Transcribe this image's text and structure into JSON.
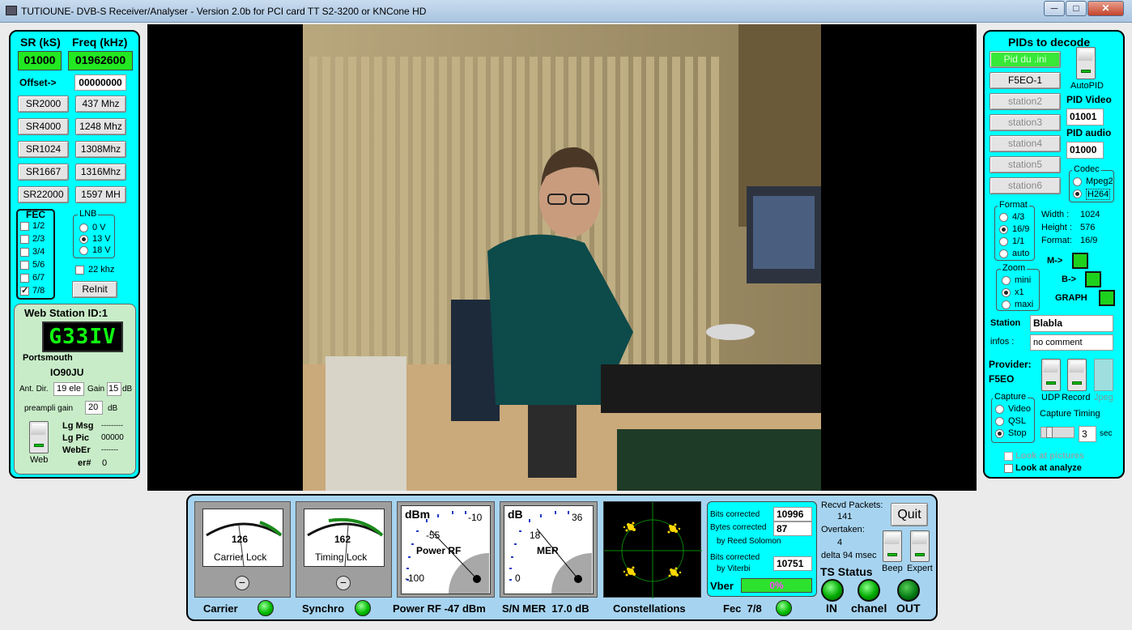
{
  "window": {
    "title": "TUTIOUNE- DVB-S Receiver/Analyser - Version 2.0b for PCI card TT S2-3200 or KNCone HD",
    "btn_min": "─",
    "btn_max": "□",
    "btn_close": "✕"
  },
  "left": {
    "sr_label": "SR (kS)",
    "freq_label": "Freq (kHz)",
    "sr_value": "01000",
    "freq_value": "01962600",
    "offset_label": "Offset->",
    "offset_value": "00000000",
    "sr_buttons": [
      "SR2000",
      "SR4000",
      "SR1024",
      "SR1667",
      "SR22000"
    ],
    "freq_buttons": [
      "437 Mhz",
      "1248 Mhz",
      "1308Mhz",
      "1316Mhz",
      "1597 MH"
    ],
    "fec_label": "FEC",
    "fec_options": [
      {
        "label": "1/2",
        "checked": false
      },
      {
        "label": "2/3",
        "checked": false
      },
      {
        "label": "3/4",
        "checked": false
      },
      {
        "label": "5/6",
        "checked": false
      },
      {
        "label": "6/7",
        "checked": false
      },
      {
        "label": "7/8",
        "checked": true
      }
    ],
    "lnb_label": "LNB",
    "lnb_options": [
      {
        "label": "0 V",
        "selected": false
      },
      {
        "label": "13 V",
        "selected": true
      },
      {
        "label": "18 V",
        "selected": false
      }
    ],
    "khz_label": "22 khz",
    "reinit_label": "ReInit",
    "web": {
      "title": "Web Station ID:1",
      "lcd": "G3ЗIV",
      "location": "Portsmouth",
      "locator": "IO90JU",
      "ant_dir_label": "Ant. Dir.",
      "ant_dir_value": "19 ele",
      "gain_label": "Gain",
      "gain_value": "15",
      "gain_unit": "dB",
      "preampli_label": "preampli gain",
      "preampli_value": "20",
      "preampli_unit": "dB",
      "web_label": "Web",
      "lg_msg_label": "Lg Msg",
      "lg_msg_value": "---------",
      "lg_pic_label": "Lg Pic",
      "lg_pic_value": "00000",
      "weber_label": "WebEr",
      "weber_value": "-------",
      "er_label": "er#",
      "er_value": "0"
    }
  },
  "right": {
    "pids_title": "PIDs to decode",
    "station_buttons": [
      {
        "label": "Pid du .ini",
        "state": "green"
      },
      {
        "label": "F5EO-1",
        "state": "normal"
      },
      {
        "label": "station2",
        "state": "dis"
      },
      {
        "label": "station3",
        "state": "dis"
      },
      {
        "label": "station4",
        "state": "dis"
      },
      {
        "label": "station5",
        "state": "dis"
      },
      {
        "label": "station6",
        "state": "dis"
      }
    ],
    "autopid_label": "AutoPID",
    "pid_video_label": "PID Video",
    "pid_video_value": "01001",
    "pid_audio_label": "PID audio",
    "pid_audio_value": "01000",
    "codec_label": "Codec",
    "codec_options": [
      {
        "label": "Mpeg2",
        "selected": false
      },
      {
        "label": "H264",
        "selected": true
      }
    ],
    "format_label": "Format",
    "format_options": [
      {
        "label": "4/3",
        "selected": false
      },
      {
        "label": "16/9",
        "selected": true
      },
      {
        "label": "1/1",
        "selected": false
      },
      {
        "label": "auto",
        "selected": false
      }
    ],
    "width_label": "Width :",
    "width_value": "1024",
    "height_label": "Height :",
    "height_value": "576",
    "fmt_label": "Format:",
    "fmt_value": "16/9",
    "zoom_label": "Zoom",
    "zoom_options": [
      {
        "label": "mini",
        "selected": false
      },
      {
        "label": "x1",
        "selected": true
      },
      {
        "label": "maxi",
        "selected": false
      }
    ],
    "m_label": "M->",
    "b_label": "B->",
    "graph_label": "GRAPH",
    "station_label": "Station",
    "station_value": "Blabla",
    "infos_label": "infos :",
    "infos_value": "no comment",
    "provider_label": "Provider:",
    "provider_value": "F5EO",
    "udp_label": "UDP",
    "record_label": "Record",
    "jpeg_label": "Jpeg",
    "capture_label": "Capture",
    "capture_options": [
      {
        "label": "Video",
        "selected": false
      },
      {
        "label": "QSL",
        "selected": false
      },
      {
        "label": "Stop",
        "selected": true
      }
    ],
    "capture_timing_label": "Capture Timing",
    "capture_timing_value": "3",
    "capture_timing_unit": "sec",
    "look_pictures_label": "Look at pictures",
    "look_analyze_label": "Look at analyze"
  },
  "bottom": {
    "carrier_value": "126",
    "carrier_lock_label": "Carrier Lock",
    "timing_value": "162",
    "timing_lock_label": "Timing Lock",
    "power_unit": "dBm",
    "power_scale": [
      "-10",
      "-55",
      "-100"
    ],
    "power_label": "Power RF",
    "mer_unit": "dB",
    "mer_scale": [
      "36",
      "18",
      "0"
    ],
    "mer_label": "MER",
    "bits_corrected_label": "Bits corrected",
    "bits_corrected_value": "10996",
    "bytes_corrected_label": "Bytes corrected",
    "bytes_corrected_value": "87",
    "reed_solomon_label": "by Reed Solomon",
    "bits_corrected2_label": "Bits corrected",
    "bits_corrected2_value": "10751",
    "viterbi_label": "by Viterbi",
    "vber_label": "Vber",
    "vber_value": "0%",
    "recvd_label": "Recvd Packets:",
    "recvd_value": "141",
    "overtaken_label": "Overtaken:",
    "overtaken_value": "4",
    "delta_label": "delta 94 msec",
    "quit_label": "Quit",
    "beep_label": "Beep",
    "expert_label": "Expert",
    "ts_status_label": "TS Status",
    "in_label": "IN",
    "chanel_label": "chanel",
    "out_label": "OUT",
    "carrier_label": "Carrier",
    "synchro_label": "Synchro",
    "power_rf_readout": "Power RF -47 dBm",
    "mer_readout": "S/N MER  17.0 dB",
    "constellations_label": "Constellations",
    "fec_readout": "Fec  7/8"
  },
  "colors": {
    "panel": "#00ffff",
    "led_green": "#00c000",
    "field_green": "#22e822"
  }
}
